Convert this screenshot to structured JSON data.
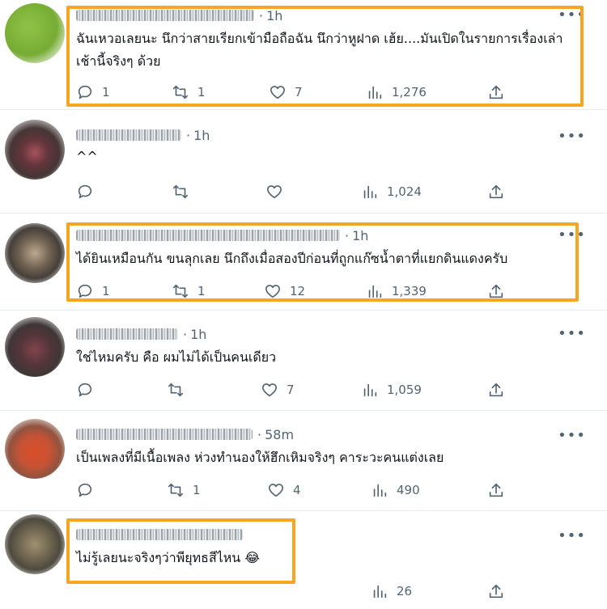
{
  "tweets": [
    {
      "time": "1h",
      "text": "ฉันเหวอเลยนะ นึกว่าสายเรียกเข้ามือถือฉัน นึกว่าหูฝาด เฮ้ย....มันเปิดในรายการเรื่องเล่าเช้านี้จริงๆ ด้วย",
      "reply": "1",
      "retweet": "1",
      "like": "7",
      "views": "1,276"
    },
    {
      "time": "1h",
      "text": "^^",
      "reply": "",
      "retweet": "",
      "like": "",
      "views": "1,024"
    },
    {
      "time": "1h",
      "text": "ได้ยินเหมือนกัน ขนลุกเลย นึกถึงเมื่อสองปีก่อนที่ถูกแก๊ซน้ำตาที่แยกดินแดงครับ",
      "reply": "1",
      "retweet": "1",
      "like": "12",
      "views": "1,339"
    },
    {
      "time": "1h",
      "text": "ใช่ไหมครับ คือ ผมไม่ได้เป็นคนเดียว",
      "reply": "",
      "retweet": "",
      "like": "7",
      "views": "1,059"
    },
    {
      "time": "58m",
      "text": "เป็นเพลงที่มีเนื้อเพลง ห่วงทำนองให้ฮึกเหิมจริงๆ คาระวะคนแต่งเลย",
      "reply": "",
      "retweet": "1",
      "like": "4",
      "views": "490"
    },
    {
      "time": "",
      "text": "ไม่รู้เลยนะจริงๆว่าพียุทธสีไหน 😂",
      "reply": "",
      "retweet": "",
      "like": "",
      "views": "26"
    }
  ],
  "more_label": "•••",
  "dot": "·",
  "colors": {
    "highlight": "#f5a623",
    "muted": "#536471"
  }
}
